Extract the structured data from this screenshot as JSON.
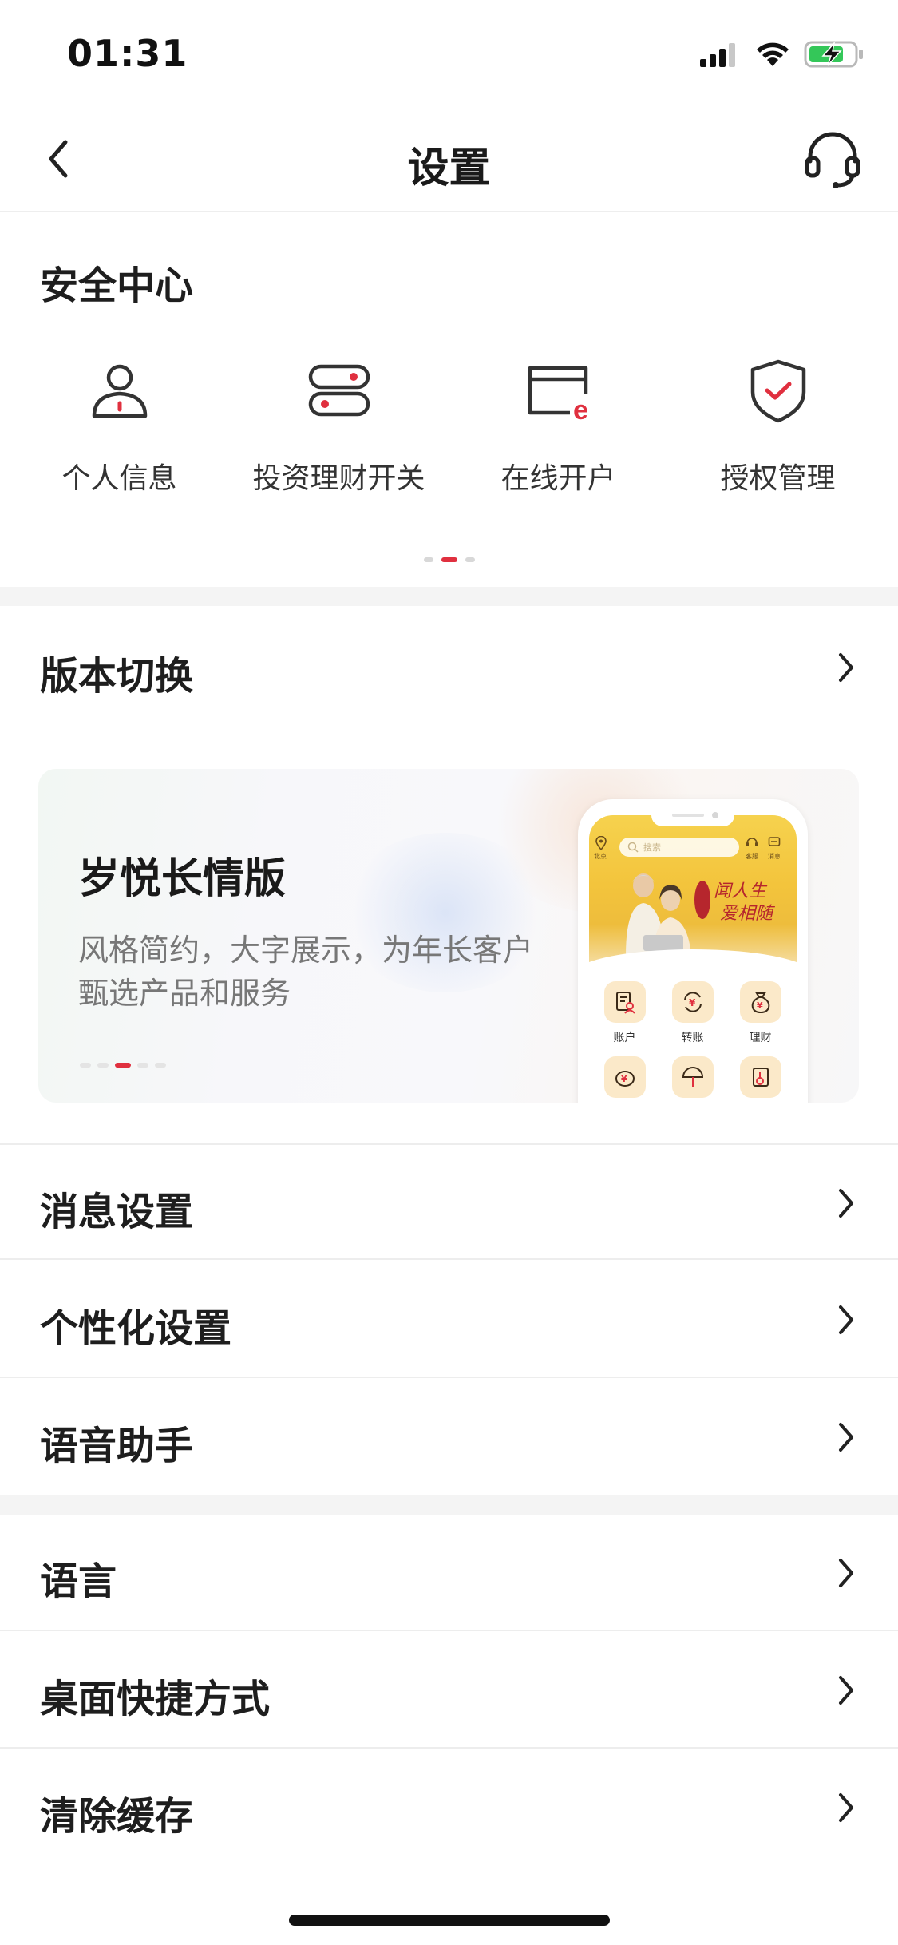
{
  "status_bar": {
    "time": "01:31",
    "icons": [
      "signal-icon",
      "wifi-icon",
      "battery-charging-icon"
    ]
  },
  "nav": {
    "title": "设置",
    "back_icon": "chevron-left-icon",
    "service_icon": "headset-icon"
  },
  "security_center": {
    "title": "安全中心",
    "items": [
      {
        "label": "个人信息",
        "icon": "person-icon"
      },
      {
        "label": "投资理财开关",
        "icon": "toggle-switch-icon"
      },
      {
        "label": "在线开户",
        "icon": "online-account-icon"
      },
      {
        "label": "授权管理",
        "icon": "shield-check-icon"
      }
    ],
    "page_indicator": {
      "count": 3,
      "active": 1
    }
  },
  "version": {
    "label": "版本切换",
    "banner": {
      "title": "岁悦长情版",
      "description": "风格简约，大字展示，为年长客户甄选产品和服务",
      "dots": {
        "count": 5,
        "active": 2
      },
      "phone_preview": {
        "search_placeholder": "搜索",
        "top_labels": [
          "北京",
          "客服",
          "消息"
        ],
        "calligraphy_line1": "闻人生",
        "calligraphy_line2": "爱相随",
        "grid": [
          {
            "label": "账户",
            "icon": "account-doc-icon"
          },
          {
            "label": "转账",
            "icon": "yuan-transfer-icon"
          },
          {
            "label": "理财",
            "icon": "money-bag-icon"
          },
          {
            "label": "",
            "icon": "piggy-bank-icon"
          },
          {
            "label": "",
            "icon": "umbrella-icon"
          },
          {
            "label": "",
            "icon": "wheelchair-icon"
          }
        ]
      }
    }
  },
  "list_group_1": [
    {
      "label": "消息设置"
    },
    {
      "label": "个性化设置"
    },
    {
      "label": "语音助手"
    }
  ],
  "list_group_2": [
    {
      "label": "语言"
    },
    {
      "label": "桌面快捷方式"
    },
    {
      "label": "清除缓存"
    }
  ],
  "colors": {
    "accent": "#e0303f",
    "text_primary": "#1e1e1e",
    "text_secondary": "#777777",
    "divider": "#ededed",
    "section_gap": "#f4f4f4"
  }
}
